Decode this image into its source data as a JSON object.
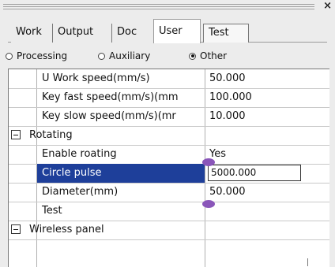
{
  "window": {
    "close_glyph": "×"
  },
  "tabs": [
    {
      "label": "Work",
      "active": false
    },
    {
      "label": "Output",
      "active": false
    },
    {
      "label": "Doc",
      "active": false
    },
    {
      "label": "User",
      "active": true
    },
    {
      "label": "Test",
      "active": false
    }
  ],
  "radios": [
    {
      "label": "Processing",
      "checked": false
    },
    {
      "label": "Auxiliary",
      "checked": false
    },
    {
      "label": "Other",
      "checked": true
    }
  ],
  "grid": {
    "rows": [
      {
        "name": "U Work speed(mm/s)",
        "value": "50.000"
      },
      {
        "name": "Key fast speed(mm/s)(mm",
        "value": "100.000"
      },
      {
        "name": "Key slow speed(mm/s)(mr",
        "value": "10.000"
      },
      {
        "name": "Rotating",
        "value": "",
        "group": true,
        "expanded": true
      },
      {
        "name": "Enable roating",
        "value": "Yes"
      },
      {
        "name": "Circle pulse",
        "value": "5000.000",
        "selected": true,
        "editing": true
      },
      {
        "name": "Diameter(mm)",
        "value": "50.000"
      },
      {
        "name": "Test",
        "value": ""
      },
      {
        "name": "Wireless panel",
        "value": "",
        "group": true,
        "expanded": true
      }
    ]
  },
  "colors": {
    "selection": "#1e3f9a",
    "marker": "#8a56b9"
  }
}
